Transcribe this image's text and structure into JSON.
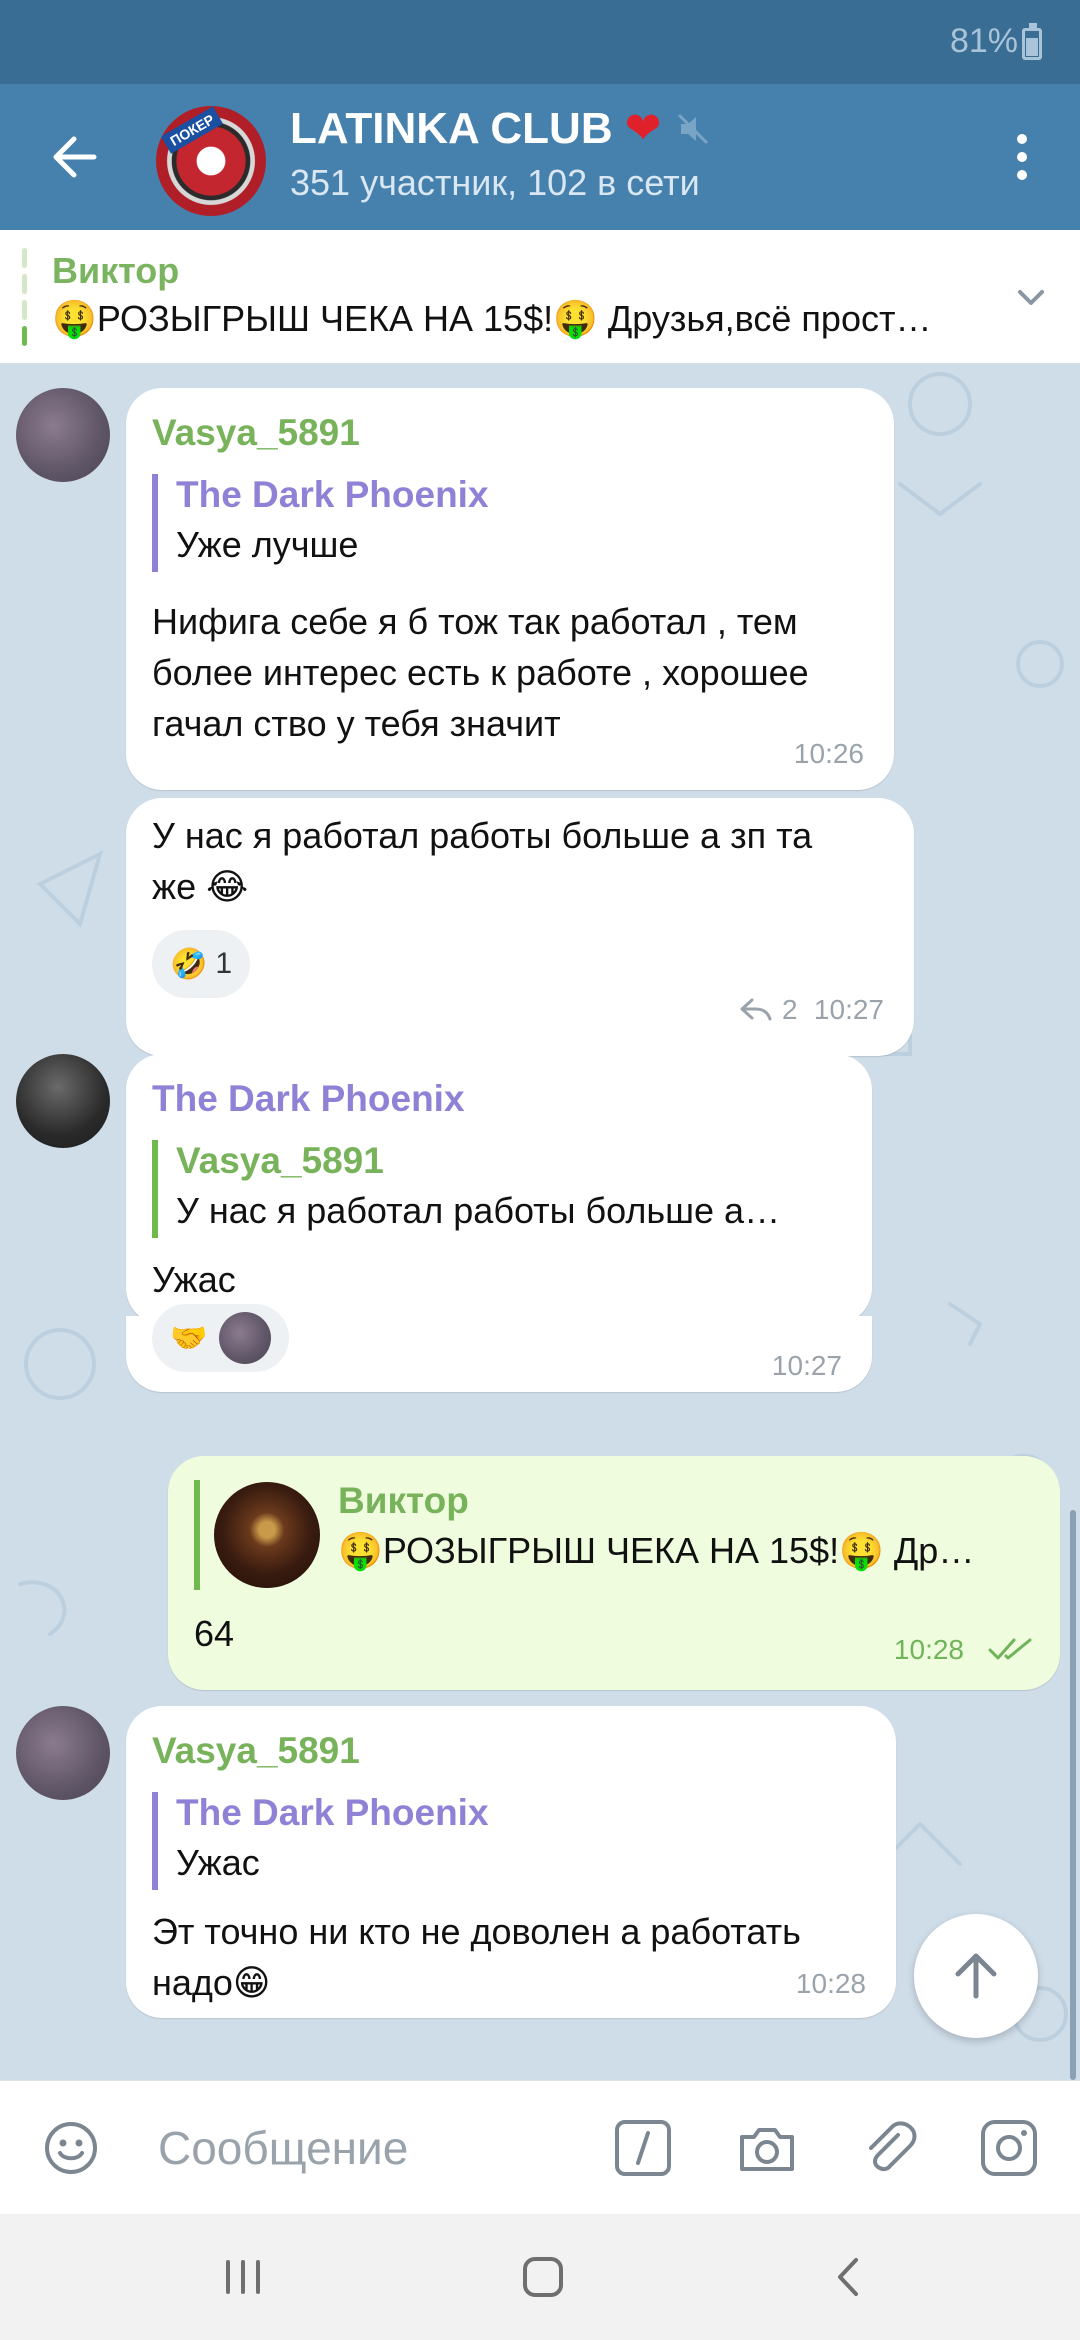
{
  "status_bar": {
    "battery": "81%"
  },
  "header": {
    "title": "LATINKA CLUB",
    "subtitle": "351 участник, 102 в сети",
    "avatar_text": "ПОКЕР"
  },
  "pinned": {
    "sender": "Виктор",
    "text": "🤑РОЗЫГРЫШ ЧЕКА НА 15$!🤑 Друзья,всё прост…"
  },
  "messages": [
    {
      "sender": "Vasya_5891",
      "reply_name": "The Dark Phoenix",
      "reply_text": "Уже лучше",
      "lines": [
        "Нифига себе я б тож так работал , тем",
        "более интерес есть к работе , хорошее",
        "гачал ство у тебя значит"
      ],
      "time": "10:26"
    },
    {
      "lines": [
        "У нас я работал работы больше  а зп та",
        "же 😂"
      ],
      "reaction_emoji": "🤣",
      "reaction_count": "1",
      "reply_count": "2",
      "time": "10:27"
    },
    {
      "sender": "The Dark Phoenix",
      "reply_name": "Vasya_5891",
      "reply_text": "У нас я работал работы больше  а…",
      "lines": [
        "Ужас"
      ],
      "reaction_emoji": "🤝",
      "time": "10:27"
    },
    {
      "reply_name": "Виктор",
      "reply_text": "🤑РОЗЫГРЫШ ЧЕКА НА 15$!🤑 Др…",
      "lines": [
        "64"
      ],
      "time": "10:28"
    },
    {
      "sender": "Vasya_5891",
      "reply_name": "The Dark Phoenix",
      "reply_text": "Ужас",
      "lines": [
        "Эт точно ни кто не доволен а работать",
        "надо😁"
      ],
      "time": "10:28"
    }
  ],
  "input": {
    "placeholder": "Сообщение"
  },
  "colors": {
    "header": "#4680ad",
    "status_bar": "#3a6d93",
    "chat_bg": "#cfdde9",
    "outgoing_bubble": "#effdde",
    "green_name": "#78b35b",
    "purple_name": "#8f82d6"
  },
  "icons": {
    "back": "arrow-left-icon",
    "heart": "heart-icon",
    "mute": "mute-icon",
    "more": "more-vertical-icon",
    "pinned_expand": "chevron-down-icon",
    "reply_count": "reply-arrow-icon",
    "read": "double-check-icon",
    "scroll_down": "arrow-up-icon",
    "emoji": "smiley-icon",
    "commands": "slash-command-icon",
    "camera": "camera-icon",
    "attach": "paperclip-icon",
    "instagram": "instagram-icon"
  }
}
